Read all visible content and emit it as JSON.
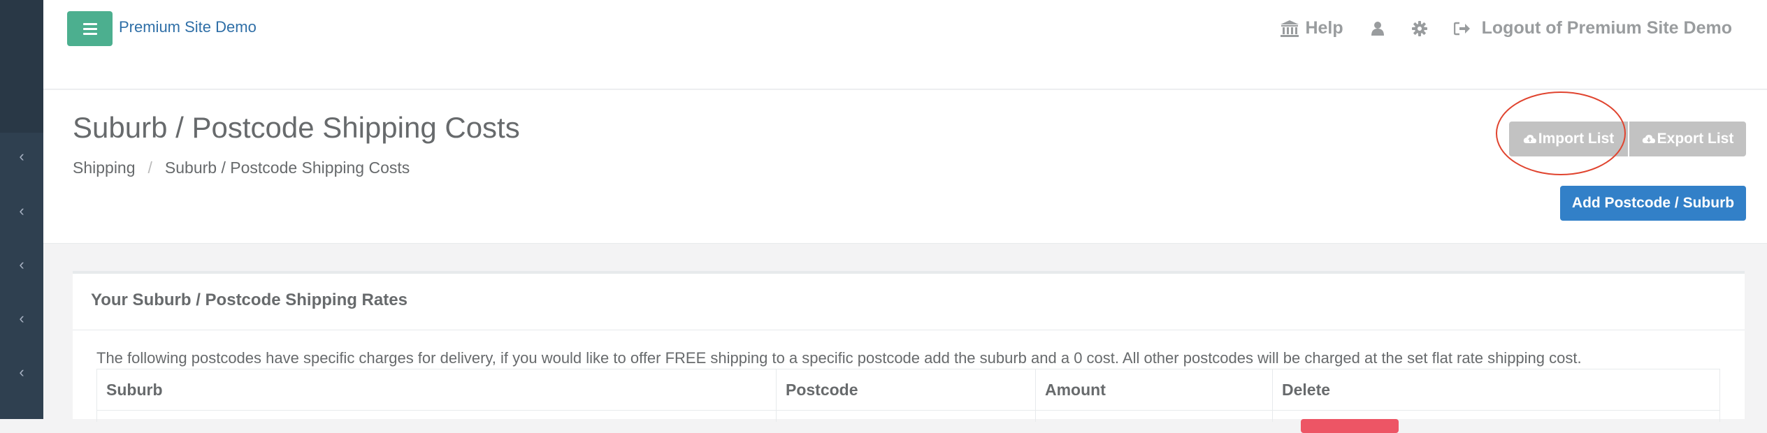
{
  "header": {
    "site_name": "Premium Site Demo",
    "nav": {
      "help_label": "Help",
      "logout_label": "Logout of Premium Site Demo"
    }
  },
  "page": {
    "title": "Suburb / Postcode Shipping Costs",
    "breadcrumb": [
      "Shipping",
      "Suburb / Postcode Shipping Costs"
    ],
    "breadcrumb_separator": "/",
    "buttons": {
      "import": "Import List",
      "export": "Export List",
      "add": "Add Postcode / Suburb"
    }
  },
  "panel": {
    "title": "Your Suburb / Postcode Shipping Rates",
    "description": "The following postcodes have specific charges for delivery, if you would like to offer FREE shipping to a specific postcode add the suburb and a 0 cost. All other postcodes will be charged at the set flat rate shipping cost.",
    "table": {
      "columns": [
        "Suburb",
        "Postcode",
        "Amount",
        "Delete"
      ]
    }
  },
  "colors": {
    "sidebar": "#2f4050",
    "menu_button": "#4caf8f",
    "link": "#2f6fa7",
    "muted_button": "#c2c2c2",
    "primary_button": "#3280c8",
    "annotation": "#e0442f",
    "delete_button": "#ed5565"
  },
  "icons": {
    "menu": "hamburger-icon",
    "help": "bank-icon",
    "user": "user-icon",
    "settings": "gear-icon",
    "logout": "sign-out-icon",
    "import": "cloud-upload-icon",
    "export": "cloud-download-icon",
    "sidebar": "chevron-left-icon"
  }
}
